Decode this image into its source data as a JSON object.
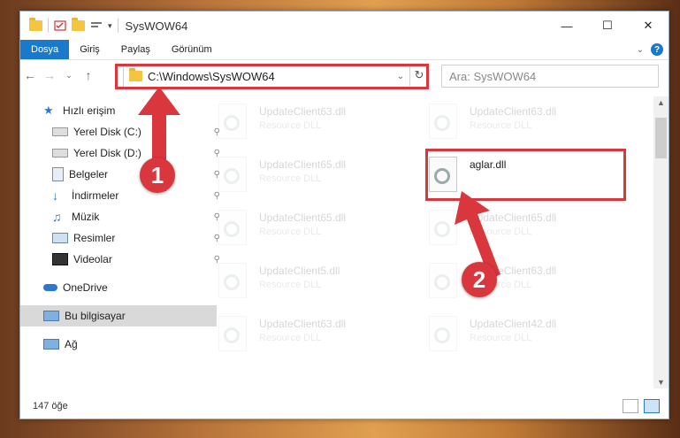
{
  "window": {
    "title": "SysWOW64"
  },
  "ribbon": {
    "tabs": [
      "Dosya",
      "Giriş",
      "Paylaş",
      "Görünüm"
    ],
    "active_tab": "Dosya",
    "help": "?"
  },
  "address": {
    "path": "C:\\Windows\\SysWOW64",
    "refresh_icon": "refresh-icon"
  },
  "search": {
    "placeholder": "Ara: SysWOW64"
  },
  "nav": {
    "items": [
      {
        "label": "Hızlı erişim",
        "icon": "star-icon",
        "pinned": false
      },
      {
        "label": "Yerel Disk (C:)",
        "icon": "drive-icon",
        "pinned": true
      },
      {
        "label": "Yerel Disk (D:)",
        "icon": "drive-icon",
        "pinned": true
      },
      {
        "label": "Belgeler",
        "icon": "documents-icon",
        "pinned": true
      },
      {
        "label": "İndirmeler",
        "icon": "download-icon",
        "pinned": true
      },
      {
        "label": "Müzik",
        "icon": "music-icon",
        "pinned": true
      },
      {
        "label": "Resimler",
        "icon": "pictures-icon",
        "pinned": true
      },
      {
        "label": "Videolar",
        "icon": "video-icon",
        "pinned": true
      },
      {
        "label": "OneDrive",
        "icon": "cloud-icon",
        "pinned": false
      },
      {
        "label": "Bu bilgisayar",
        "icon": "computer-icon",
        "pinned": false
      },
      {
        "label": "Ağ",
        "icon": "network-icon",
        "pinned": false
      }
    ],
    "selected": "Bu bilgisayar"
  },
  "files": {
    "left_column": [
      {
        "name": "UpdateClient63.dll",
        "type": "Resource DLL"
      },
      {
        "name": "UpdateClient65.dll",
        "type": "Resource DLL"
      },
      {
        "name": "UpdateClient65.dll",
        "type": "Resource DLL"
      },
      {
        "name": "UpdateClient5.dll",
        "type": "Resource DLL"
      },
      {
        "name": "UpdateClient63.dll",
        "type": "Resource DLL"
      }
    ],
    "right_column": [
      {
        "name": "UpdateClient63.dll",
        "type": "Resource DLL"
      },
      {
        "name": "aglar.dll",
        "type": ""
      },
      {
        "name": "UpdateClient65.dll",
        "type": "Resource DLL"
      },
      {
        "name": "UpdateClient63.dll",
        "type": "Resource DLL"
      },
      {
        "name": "UpdateClient42.dll",
        "type": "Resource DLL"
      }
    ]
  },
  "status": {
    "count": "147 öğe"
  },
  "annotations": {
    "step1": "1",
    "step2": "2",
    "color": "#d9363e"
  }
}
